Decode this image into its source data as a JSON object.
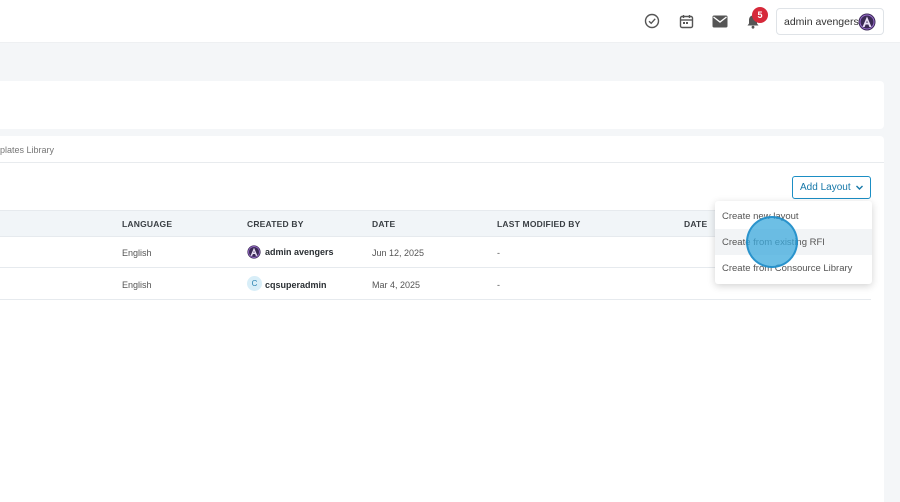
{
  "header": {
    "notification_count": "5",
    "user_name": "admin avengers",
    "icons": [
      "check-circle-icon",
      "calendar-icon",
      "mail-icon",
      "bell-icon"
    ]
  },
  "breadcrumb": {
    "text": "plates Library"
  },
  "toolbar": {
    "add_layout_label": "Add Layout"
  },
  "table": {
    "columns": [
      "LANGUAGE",
      "CREATED BY",
      "DATE",
      "LAST MODIFIED BY",
      "DATE"
    ],
    "rows": [
      {
        "language": "English",
        "created_by": "admin avengers",
        "date": "Jun 12, 2025",
        "modified_by": "-"
      },
      {
        "language": "English",
        "created_by": "cqsuperadmin",
        "created_initial": "C",
        "date": "Mar 4, 2025",
        "modified_by": "-"
      }
    ]
  },
  "dropdown": {
    "items": [
      "Create new layout",
      "Create from existing RFI",
      "Create from Consource Library"
    ]
  },
  "colors": {
    "accent": "#1b8ec4",
    "badge": "#d6293a",
    "header_bg": "#f1f5f8"
  }
}
